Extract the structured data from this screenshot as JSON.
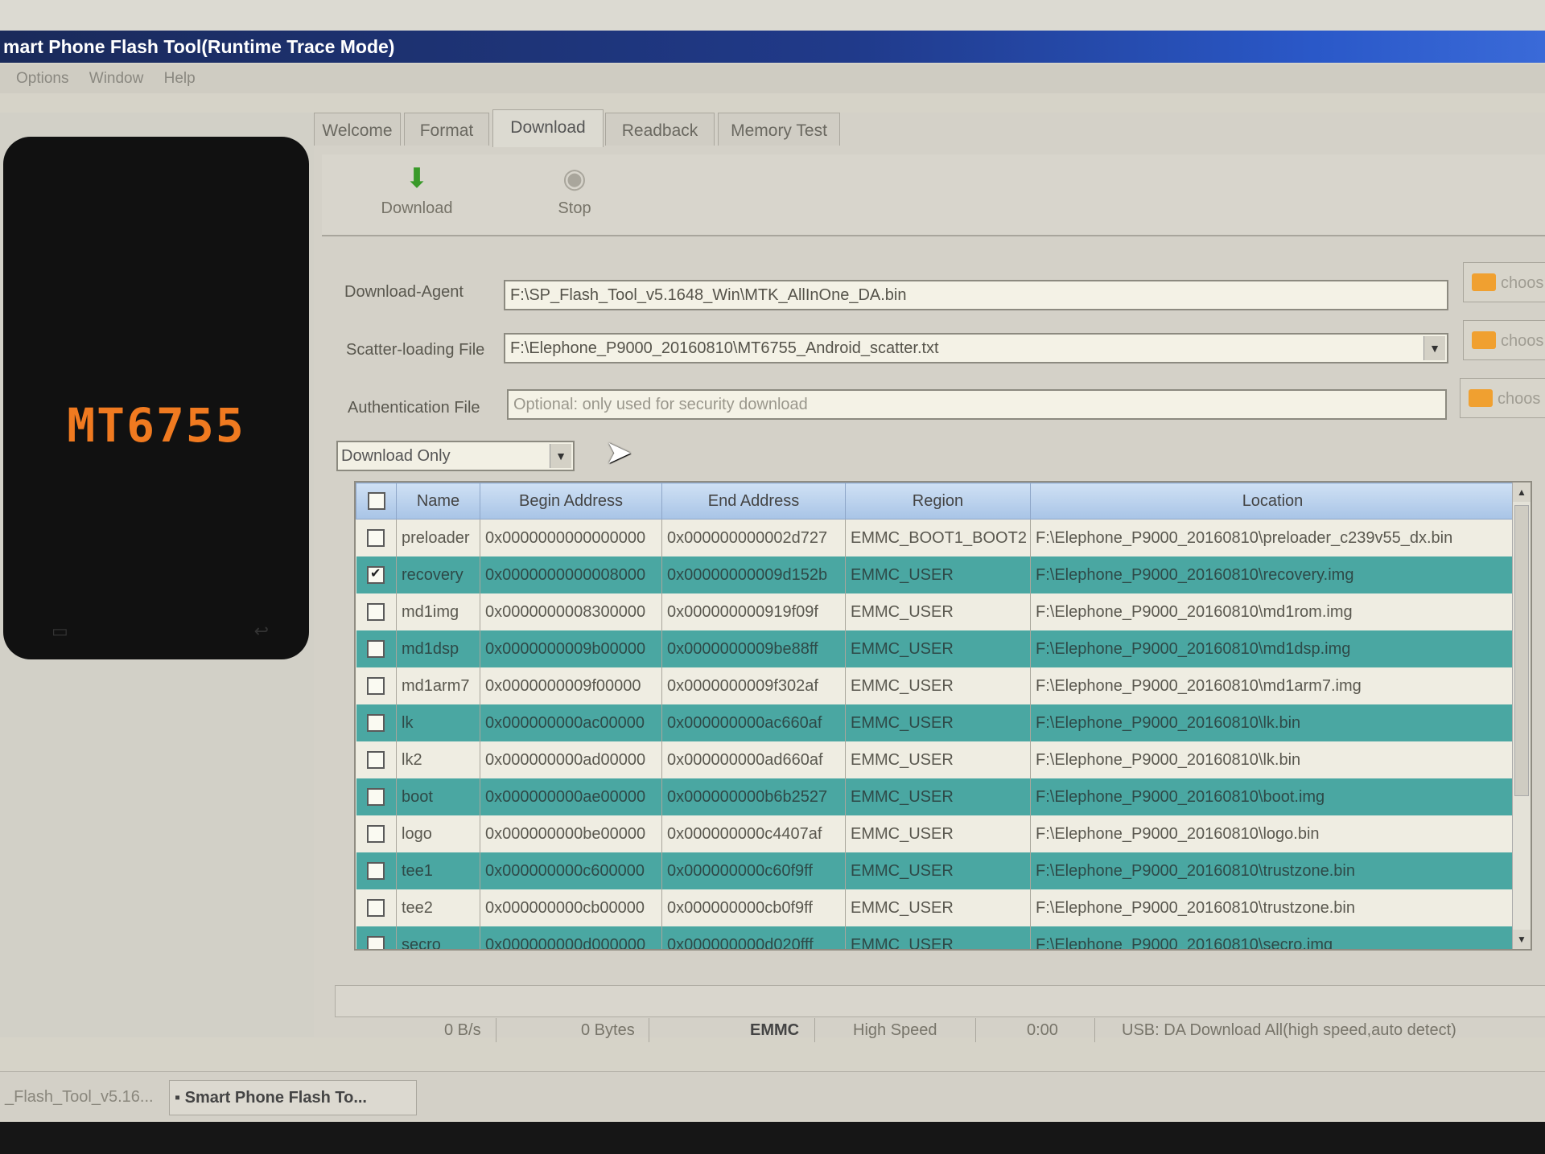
{
  "window": {
    "title": "mart Phone Flash Tool(Runtime Trace Mode)"
  },
  "menu": [
    "Options",
    "Window",
    "Help"
  ],
  "device": {
    "chip": "MT6755"
  },
  "tabs": [
    "Welcome",
    "Format",
    "Download",
    "Readback",
    "Memory Test"
  ],
  "active_tab": "Download",
  "toolbar": {
    "download_label": "Download",
    "stop_label": "Stop"
  },
  "form": {
    "download_agent_label": "Download-Agent",
    "download_agent_value": "F:\\SP_Flash_Tool_v5.1648_Win\\MTK_AllInOne_DA.bin",
    "scatter_label": "Scatter-loading File",
    "scatter_value": "F:\\Elephone_P9000_20160810\\MT6755_Android_scatter.txt",
    "auth_label": "Authentication File",
    "auth_placeholder": "Optional: only used for security download",
    "choose_label": "choos",
    "mode": "Download Only"
  },
  "table": {
    "headers": [
      "Name",
      "Begin Address",
      "End Address",
      "Region",
      "Location"
    ],
    "rows": [
      {
        "checked": false,
        "name": "preloader",
        "begin": "0x0000000000000000",
        "end": "0x000000000002d727",
        "region": "EMMC_BOOT1_BOOT2",
        "location": "F:\\Elephone_P9000_20160810\\preloader_c239v55_dx.bin"
      },
      {
        "checked": true,
        "name": "recovery",
        "begin": "0x0000000000008000",
        "end": "0x00000000009d152b",
        "region": "EMMC_USER",
        "location": "F:\\Elephone_P9000_20160810\\recovery.img"
      },
      {
        "checked": false,
        "name": "md1img",
        "begin": "0x0000000008300000",
        "end": "0x000000000919f09f",
        "region": "EMMC_USER",
        "location": "F:\\Elephone_P9000_20160810\\md1rom.img"
      },
      {
        "checked": false,
        "name": "md1dsp",
        "begin": "0x0000000009b00000",
        "end": "0x0000000009be88ff",
        "region": "EMMC_USER",
        "location": "F:\\Elephone_P9000_20160810\\md1dsp.img"
      },
      {
        "checked": false,
        "name": "md1arm7",
        "begin": "0x0000000009f00000",
        "end": "0x0000000009f302af",
        "region": "EMMC_USER",
        "location": "F:\\Elephone_P9000_20160810\\md1arm7.img"
      },
      {
        "checked": false,
        "name": "lk",
        "begin": "0x000000000ac00000",
        "end": "0x000000000ac660af",
        "region": "EMMC_USER",
        "location": "F:\\Elephone_P9000_20160810\\lk.bin"
      },
      {
        "checked": false,
        "name": "lk2",
        "begin": "0x000000000ad00000",
        "end": "0x000000000ad660af",
        "region": "EMMC_USER",
        "location": "F:\\Elephone_P9000_20160810\\lk.bin"
      },
      {
        "checked": false,
        "name": "boot",
        "begin": "0x000000000ae00000",
        "end": "0x000000000b6b2527",
        "region": "EMMC_USER",
        "location": "F:\\Elephone_P9000_20160810\\boot.img"
      },
      {
        "checked": false,
        "name": "logo",
        "begin": "0x000000000be00000",
        "end": "0x000000000c4407af",
        "region": "EMMC_USER",
        "location": "F:\\Elephone_P9000_20160810\\logo.bin"
      },
      {
        "checked": false,
        "name": "tee1",
        "begin": "0x000000000c600000",
        "end": "0x000000000c60f9ff",
        "region": "EMMC_USER",
        "location": "F:\\Elephone_P9000_20160810\\trustzone.bin"
      },
      {
        "checked": false,
        "name": "tee2",
        "begin": "0x000000000cb00000",
        "end": "0x000000000cb0f9ff",
        "region": "EMMC_USER",
        "location": "F:\\Elephone_P9000_20160810\\trustzone.bin"
      },
      {
        "checked": false,
        "name": "secro",
        "begin": "0x000000000d000000",
        "end": "0x000000000d020fff",
        "region": "EMMC_USER",
        "location": "F:\\Elephone_P9000_20160810\\secro.img"
      }
    ]
  },
  "status": {
    "speed": "0 B/s",
    "bytes": "0 Bytes",
    "storage": "EMMC",
    "usb_speed": "High Speed",
    "time": "0:00",
    "usb_mode": "USB: DA Download All(high speed,auto detect)"
  },
  "taskbar": [
    "_Flash_Tool_v5.16...",
    "Smart Phone Flash To..."
  ],
  "colors": {
    "teal_row": "#4aa7a2",
    "chip_text": "#f07a20",
    "title_bar": "#203a8a"
  }
}
